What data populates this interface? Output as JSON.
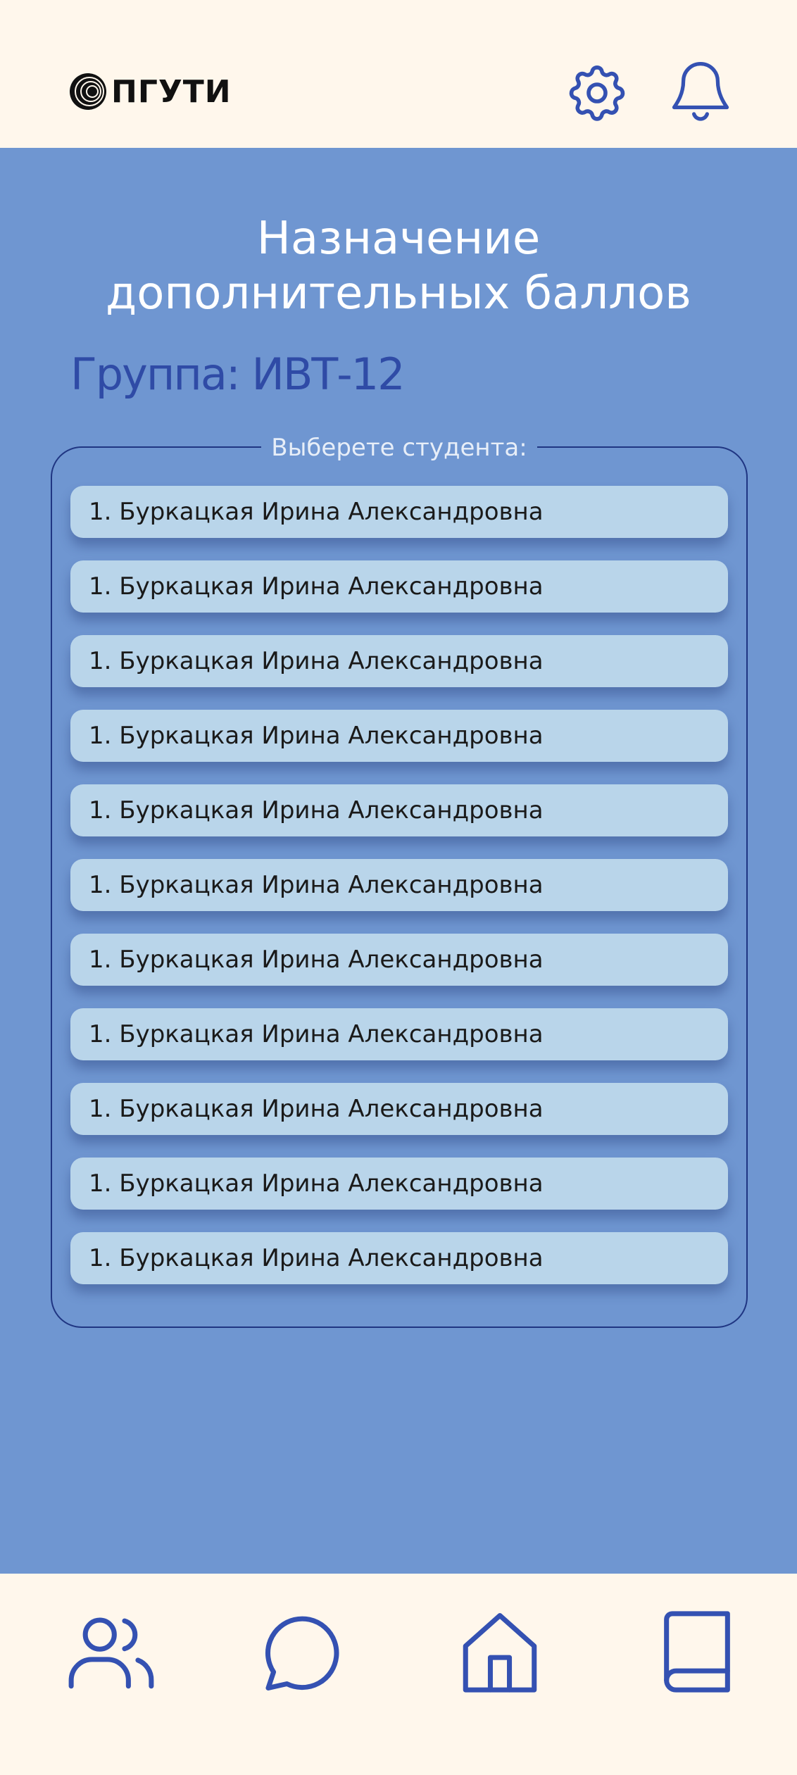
{
  "header": {
    "logo_text": "ПГУТИ",
    "icons": [
      "gear-icon",
      "bell-icon"
    ]
  },
  "page": {
    "title_line1": "Назначение",
    "title_line2": "дополнительных баллов",
    "group_label": "Группа: ИВТ-12",
    "select_legend": "Выберете студента:"
  },
  "students": [
    "1. Буркацкая Ирина Александровна",
    "1. Буркацкая Ирина Александровна",
    "1. Буркацкая Ирина Александровна",
    "1. Буркацкая Ирина Александровна",
    "1. Буркацкая Ирина Александровна",
    "1. Буркацкая Ирина Александровна",
    "1. Буркацкая Ирина Александровна",
    "1. Буркацкая Ирина Александровна",
    "1. Буркацкая Ирина Александровна",
    "1. Буркацкая Ирина Александровна",
    "1. Буркацкая Ирина Александровна"
  ],
  "navbar": {
    "icons": [
      "users-icon",
      "chat-icon",
      "home-icon",
      "book-icon"
    ]
  },
  "colors": {
    "background": "#FFF7EC",
    "main": "#6F96D1",
    "accent": "#2F4BA6",
    "item": "#B9D5EA"
  }
}
